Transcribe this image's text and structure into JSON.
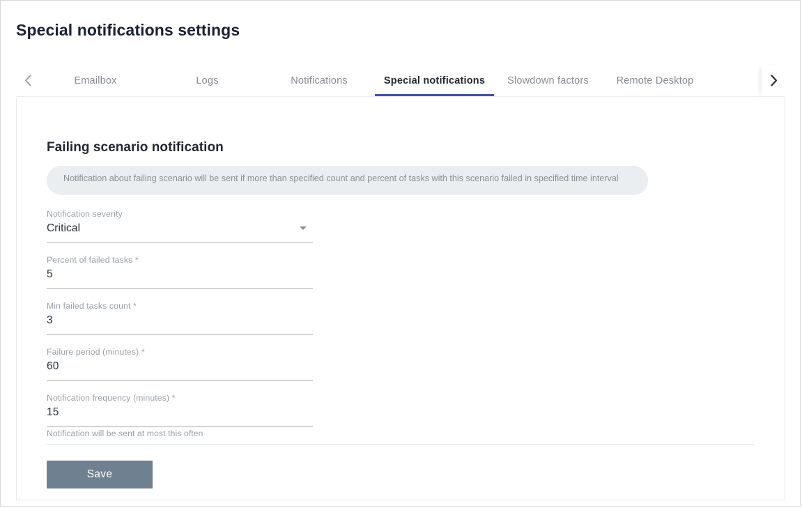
{
  "page": {
    "title": "Special notifications settings"
  },
  "tabs": {
    "prev_arrow_icon": "chevron-left-icon",
    "next_arrow_icon": "chevron-right-icon",
    "active_index": 3,
    "items": [
      {
        "label": "Emailbox"
      },
      {
        "label": "Logs"
      },
      {
        "label": "Notifications"
      },
      {
        "label": "Special notifications"
      },
      {
        "label": "Slowdown factors"
      },
      {
        "label": "Remote Desktop"
      }
    ]
  },
  "content": {
    "section_title": "Failing scenario notification",
    "hint_banner": "Notification about failing scenario will be sent if more than specified count and percent of tasks with this scenario failed in specified time interval",
    "fields": [
      {
        "label": "Notification severity",
        "value": "Critical",
        "type": "select",
        "caret_icon": "chevron-down-icon"
      },
      {
        "label": "Percent of failed tasks *",
        "value": "5",
        "type": "text"
      },
      {
        "label": "Min failed tasks count *",
        "value": "3",
        "type": "text"
      },
      {
        "label": "Failure period (minutes) *",
        "value": "60",
        "type": "text"
      },
      {
        "label": "Notification frequency (minutes) *",
        "value": "15",
        "type": "text",
        "hint": "Notification will be sent at most this often"
      }
    ],
    "save_label": "Save"
  },
  "colors": {
    "accent": "#3f51b5",
    "title": "#1b2138",
    "save_button": "#6f8190",
    "hint_banner_bg": "#eaeef0",
    "muted_text": "#9aa0a6"
  }
}
